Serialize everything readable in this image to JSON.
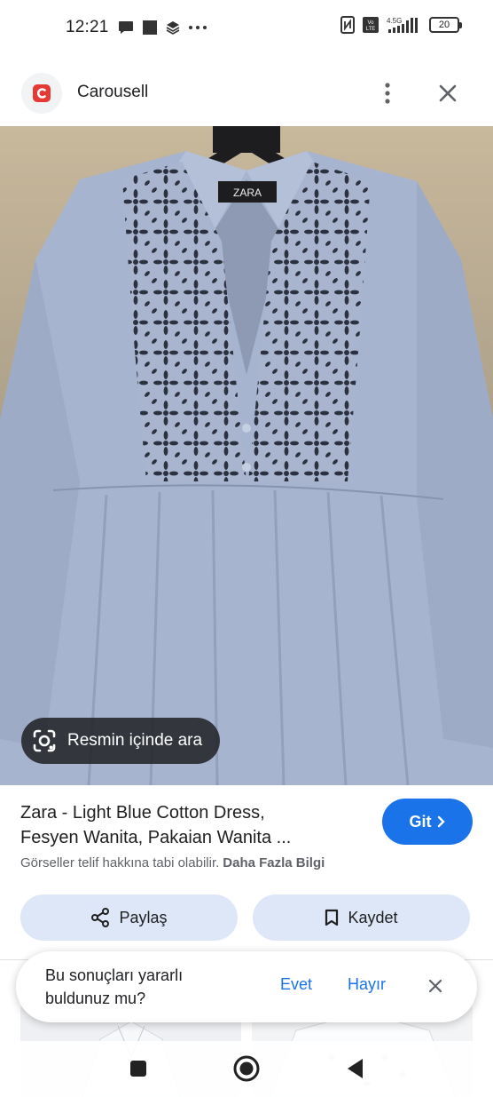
{
  "status_bar": {
    "time": "12:21",
    "network": "4.5G",
    "volte": "Vo LTE",
    "battery": "20"
  },
  "header": {
    "site_name": "Carousell"
  },
  "image": {
    "brand_label": "ZARA"
  },
  "lens_chip": {
    "label": "Resmin içinde ara"
  },
  "result": {
    "title_line1": "Zara - Light Blue Cotton Dress,",
    "title_line2": "Fesyen Wanita, Pakaian Wanita ...",
    "visit_label": "Git",
    "copyright_text": "Görseller telif hakkına tabi olabilir.",
    "learn_more": "Daha Fazla Bilgi"
  },
  "actions": {
    "share_label": "Paylaş",
    "save_label": "Kaydet"
  },
  "feedback": {
    "question_line1": "Bu sonuçları yararlı",
    "question_line2": "buldunuz mu?",
    "yes_label": "Evet",
    "no_label": "Hayır"
  },
  "colors": {
    "accent": "#1a73e8",
    "action_bg": "#dde7f8",
    "dress": "#a7b4cf"
  }
}
